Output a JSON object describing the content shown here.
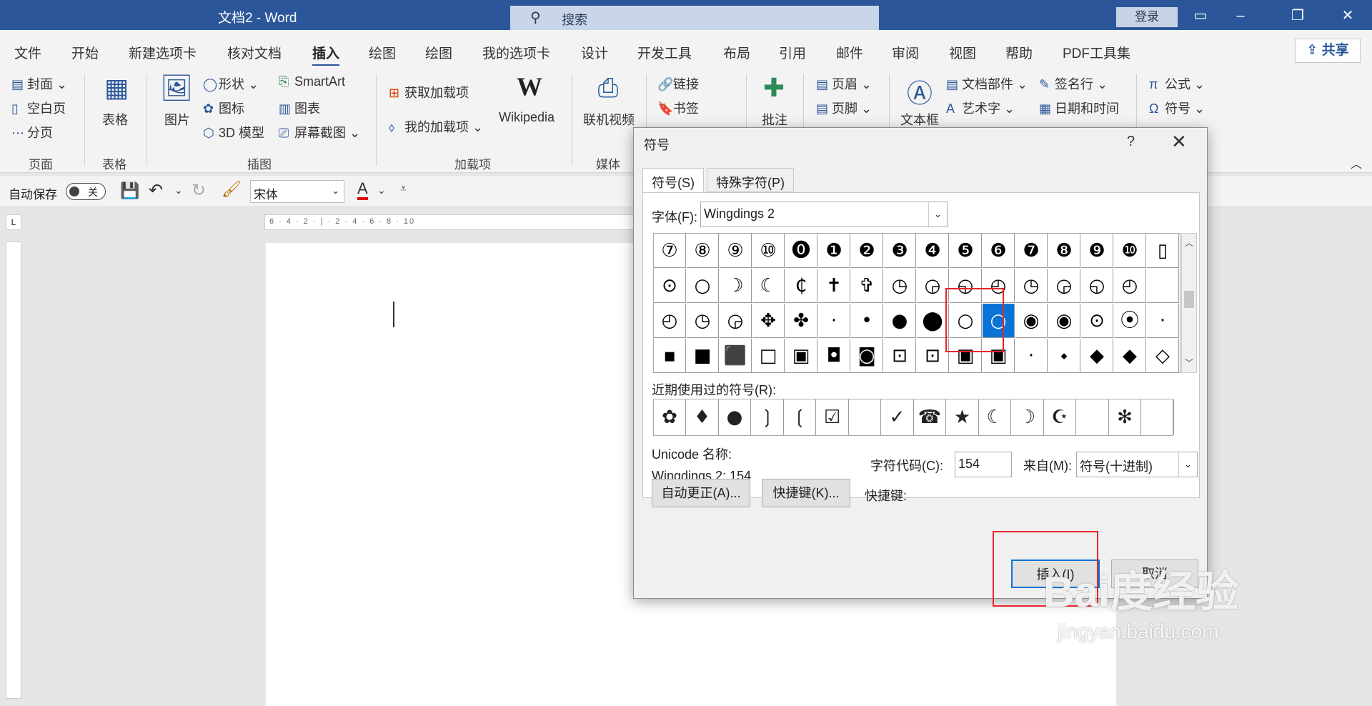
{
  "window": {
    "title": "文档2  -  Word",
    "search_placeholder": "搜索",
    "login": "登录"
  },
  "tabs": [
    "文件",
    "开始",
    "新建选项卡",
    "核对文档",
    "插入",
    "绘图",
    "绘图",
    "我的选项卡",
    "设计",
    "开发工具",
    "布局",
    "引用",
    "邮件",
    "审阅",
    "视图",
    "帮助",
    "PDF工具集"
  ],
  "share": "共享",
  "ribbon": {
    "page_group": {
      "label": "页面",
      "items": [
        "封面",
        "空白页",
        "分页"
      ]
    },
    "table_group": {
      "label": "表格",
      "button": "表格"
    },
    "illust_group": {
      "label": "插图",
      "picture": "图片",
      "items": [
        "形状",
        "图标",
        "3D 模型",
        "SmartArt",
        "图表",
        "屏幕截图"
      ]
    },
    "addins_group": {
      "label": "加载项",
      "items": [
        "获取加载项",
        "我的加载项"
      ],
      "wikipedia": "Wikipedia"
    },
    "media_group": {
      "label": "媒体",
      "online_video": "联机视频"
    },
    "links": [
      "链接",
      "书签"
    ],
    "comment": "批注",
    "header_footer": [
      "页眉",
      "页脚"
    ],
    "textbox": "文本框",
    "text_items": [
      "文档部件",
      "艺术字"
    ],
    "more_items": [
      "签名行",
      "日期和时间"
    ],
    "symbols": [
      "公式",
      "符号"
    ]
  },
  "qat": {
    "autosave": "自动保存",
    "toggle": "关",
    "font": "宋体"
  },
  "dialog": {
    "title": "符号",
    "help": "?",
    "tabs": [
      "符号(S)",
      "特殊字符(P)"
    ],
    "font_label": "字体(F):",
    "font_value": "Wingdings 2",
    "grid_rows": [
      [
        "⑦",
        "⑧",
        "⑨",
        "⑩",
        "⓿",
        "❶",
        "❷",
        "❸",
        "❹",
        "❺",
        "❻",
        "❼",
        "❽",
        "❾",
        "❿",
        "▯"
      ],
      [
        "⊙",
        "○",
        "☽",
        "☾",
        "₵",
        "✝",
        "✞",
        "◷",
        "◶",
        "◵",
        "◴",
        "◷",
        "◶",
        "◵",
        "◴",
        ""
      ],
      [
        "◴",
        "◷",
        "◶",
        "✥",
        "✤",
        "·",
        "•",
        "●",
        "⬤",
        "○",
        "○",
        "◉",
        "◉",
        "⊙",
        "⦿",
        "·"
      ],
      [
        "▪",
        "■",
        "⬛",
        "□",
        "▣",
        "◘",
        "◙",
        "⊡",
        "⊡",
        "▣",
        "▣",
        "·",
        "⬩",
        "◆",
        "◆",
        "◇"
      ]
    ],
    "recent_label": "近期使用过的符号(R):",
    "recent": [
      "✿",
      "♦",
      "●",
      "❳",
      "❲",
      "☑",
      "",
      "✓",
      "☎",
      "★",
      "☾",
      "☽",
      "☪",
      "",
      "✻",
      ""
    ],
    "unicode_label": "Unicode 名称:",
    "unicode_value": "Wingdings 2: 154",
    "charcode_label": "字符代码(C):",
    "charcode_value": "154",
    "from_label": "来自(M):",
    "from_value": "符号(十进制)",
    "autocorrect": "自动更正(A)...",
    "shortcut_btn": "快捷键(K)...",
    "shortcut_label": "快捷键:",
    "insert": "插入(I)",
    "cancel": "取消"
  },
  "watermark": {
    "brand": "Bai度经验",
    "url": "jingyan.baidu.com"
  }
}
